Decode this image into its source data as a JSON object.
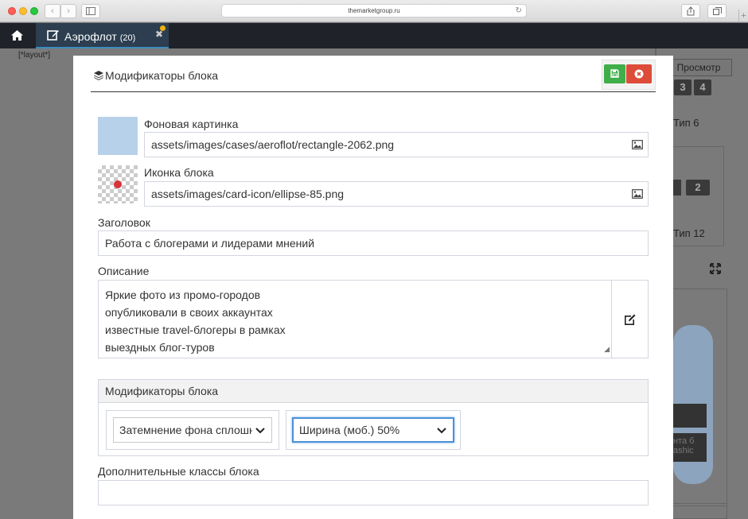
{
  "browser": {
    "url": "themarketgroup.ru",
    "back_glyph": "‹",
    "forward_glyph": "›",
    "reload_glyph": "↻"
  },
  "app_tab": {
    "title": "Аэрофлот",
    "count": "(20)"
  },
  "background": {
    "layout_label": "[*layout*]",
    "preview_button": "Просмотр",
    "numbers_top": [
      "3",
      "4"
    ],
    "tip_6": "Тип 6",
    "numbers_mid": [
      "2"
    ],
    "tip_12": "Тип 12"
  },
  "modal": {
    "title": "Модификаторы блока",
    "bg_image": {
      "label": "Фоновая картинка",
      "value": "assets/images/cases/aeroflot/rectangle-2062.png"
    },
    "icon": {
      "label": "Иконка блока",
      "value": "assets/images/card-icon/ellipse-85.png"
    },
    "heading": {
      "label": "Заголовок",
      "value": "Работа с блогерами  и лидерами мнений"
    },
    "description": {
      "label": "Описание",
      "lines": [
        "Яркие фото из промо-городов",
        "опубликовали в своих аккаунтах",
        "известные travel-блогеры в рамках",
        "выездных блог-туров"
      ]
    },
    "modifiers": {
      "header": "Модификаторы блока",
      "select1": "Затемнение фона сплошн",
      "select2": "Ширина (моб.) 50%"
    },
    "extra_classes": {
      "label": "Дополнительные классы блока",
      "value": ""
    }
  },
  "icons": {
    "home": "home-icon",
    "edit": "edit-icon",
    "save": "floppy-disk-icon",
    "close": "close-circle-icon",
    "layers": "layers-icon",
    "image": "image-icon",
    "expand": "expand-icon"
  },
  "colors": {
    "save_green": "#3fae49",
    "close_red": "#dd4b39",
    "app_bar": "#1f2228",
    "focus_blue": "#4a90d9"
  }
}
